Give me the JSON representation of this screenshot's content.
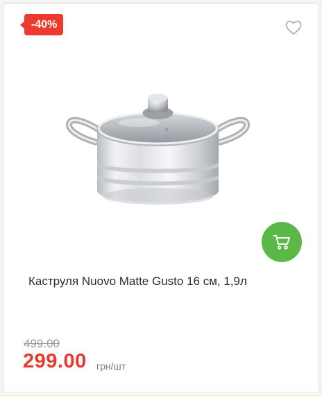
{
  "product": {
    "discount_badge": "-40%",
    "title": "Каструля Nuovo Matte Gusto 16 см, 1,9л",
    "old_price": "499.00",
    "price": "299.00",
    "unit": "грн/шт"
  },
  "icons": {
    "favorite": "heart-outline-icon",
    "cart": "shopping-cart-icon"
  },
  "colors": {
    "badge": "#ee3a2e",
    "cart_button": "#5ab946",
    "price": "#e8392f",
    "old_price": "#9a9a9a"
  }
}
